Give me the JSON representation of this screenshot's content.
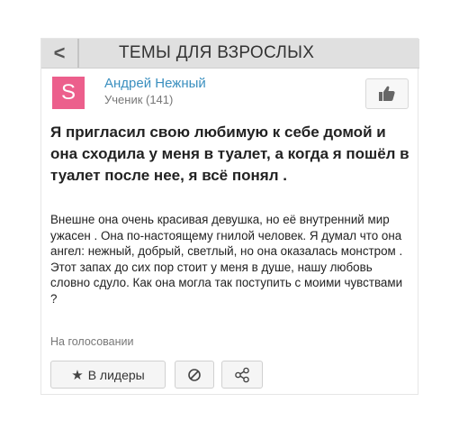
{
  "topbar": {
    "title": "ТЕМЫ ДЛЯ ВЗРОСЛЫХ",
    "back_glyph": "<"
  },
  "author": {
    "initial": "S",
    "name": "Андрей Нежный",
    "rank": "Ученик (141)",
    "avatar_color": "#ec5f8c",
    "name_color": "#3a8fbf"
  },
  "like_button": {
    "icon": "thumbs-up-icon"
  },
  "question": {
    "title": "Я пригласил свою любимую к себе домой и она сходила у меня в туалет, а когда я пошёл в туалет после нее, я всё понял .",
    "body": "Внешне она очень красивая девушка, но её внутренний мир ужасен . Она по-настоящему гнилой человек. Я думал что она ангел: нежный, добрый, светлый, но она оказалась монстром . Этот запах до сих пор стоит у меня в душе, нашу любовь словно сдуло. Как она могла так поступить с моими чувствами ?",
    "status": "На голосовании"
  },
  "actions": {
    "leaders_label": "В лидеры",
    "leaders_icon": "star-icon",
    "block_icon": "block-icon",
    "share_icon": "share-icon"
  }
}
